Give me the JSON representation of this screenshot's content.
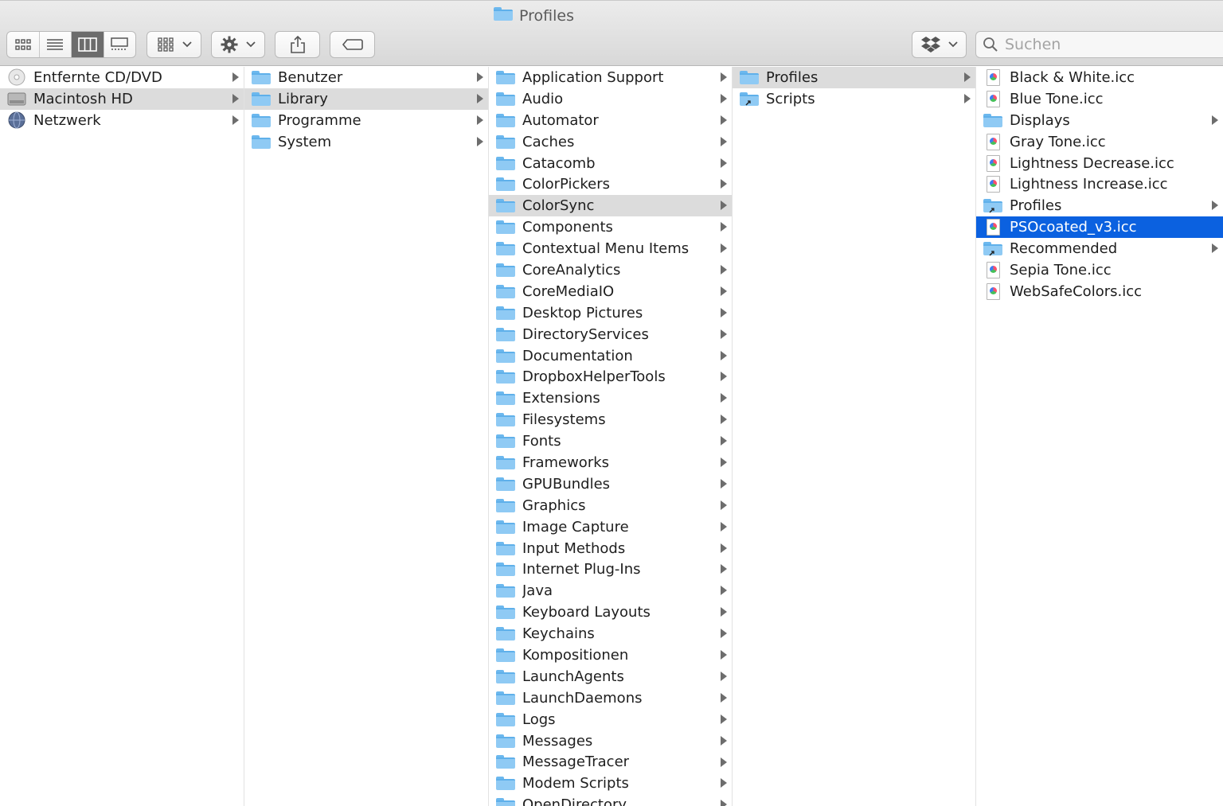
{
  "window": {
    "title": "Profiles"
  },
  "toolbar": {
    "view_buttons": [
      "icon-view",
      "list-view",
      "column-view",
      "gallery-view"
    ],
    "active_view": "column-view",
    "search_placeholder": "Suchen"
  },
  "columns": [
    {
      "items": [
        {
          "label": "Entfernte CD/DVD",
          "icon": "disc-icon",
          "chevron": true,
          "state": ""
        },
        {
          "label": "Macintosh HD",
          "icon": "harddrive-icon",
          "chevron": true,
          "state": "gray"
        },
        {
          "label": "Netzwerk",
          "icon": "globe-icon",
          "chevron": true,
          "state": ""
        }
      ]
    },
    {
      "items": [
        {
          "label": "Benutzer",
          "icon": "folder-icon",
          "chevron": true,
          "state": ""
        },
        {
          "label": "Library",
          "icon": "folder-icon",
          "chevron": true,
          "state": "gray"
        },
        {
          "label": "Programme",
          "icon": "folder-icon",
          "chevron": true,
          "state": ""
        },
        {
          "label": "System",
          "icon": "folder-icon",
          "chevron": true,
          "state": ""
        }
      ]
    },
    {
      "items": [
        {
          "label": "Application Support",
          "icon": "folder-icon",
          "chevron": true,
          "state": ""
        },
        {
          "label": "Audio",
          "icon": "folder-icon",
          "chevron": true,
          "state": ""
        },
        {
          "label": "Automator",
          "icon": "folder-icon",
          "chevron": true,
          "state": ""
        },
        {
          "label": "Caches",
          "icon": "folder-icon",
          "chevron": true,
          "state": ""
        },
        {
          "label": "Catacomb",
          "icon": "folder-icon",
          "chevron": true,
          "state": ""
        },
        {
          "label": "ColorPickers",
          "icon": "folder-icon",
          "chevron": true,
          "state": ""
        },
        {
          "label": "ColorSync",
          "icon": "folder-icon",
          "chevron": true,
          "state": "gray"
        },
        {
          "label": "Components",
          "icon": "folder-icon",
          "chevron": true,
          "state": ""
        },
        {
          "label": "Contextual Menu Items",
          "icon": "folder-icon",
          "chevron": true,
          "state": ""
        },
        {
          "label": "CoreAnalytics",
          "icon": "folder-icon",
          "chevron": true,
          "state": ""
        },
        {
          "label": "CoreMediaIO",
          "icon": "folder-icon",
          "chevron": true,
          "state": ""
        },
        {
          "label": "Desktop Pictures",
          "icon": "folder-icon",
          "chevron": true,
          "state": ""
        },
        {
          "label": "DirectoryServices",
          "icon": "folder-icon",
          "chevron": true,
          "state": ""
        },
        {
          "label": "Documentation",
          "icon": "folder-icon",
          "chevron": true,
          "state": ""
        },
        {
          "label": "DropboxHelperTools",
          "icon": "folder-icon",
          "chevron": true,
          "state": ""
        },
        {
          "label": "Extensions",
          "icon": "folder-icon",
          "chevron": true,
          "state": ""
        },
        {
          "label": "Filesystems",
          "icon": "folder-icon",
          "chevron": true,
          "state": ""
        },
        {
          "label": "Fonts",
          "icon": "folder-icon",
          "chevron": true,
          "state": ""
        },
        {
          "label": "Frameworks",
          "icon": "folder-icon",
          "chevron": true,
          "state": ""
        },
        {
          "label": "GPUBundles",
          "icon": "folder-icon",
          "chevron": true,
          "state": ""
        },
        {
          "label": "Graphics",
          "icon": "folder-icon",
          "chevron": true,
          "state": ""
        },
        {
          "label": "Image Capture",
          "icon": "folder-icon",
          "chevron": true,
          "state": ""
        },
        {
          "label": "Input Methods",
          "icon": "folder-icon",
          "chevron": true,
          "state": ""
        },
        {
          "label": "Internet Plug-Ins",
          "icon": "folder-icon",
          "chevron": true,
          "state": ""
        },
        {
          "label": "Java",
          "icon": "folder-icon",
          "chevron": true,
          "state": ""
        },
        {
          "label": "Keyboard Layouts",
          "icon": "folder-icon",
          "chevron": true,
          "state": ""
        },
        {
          "label": "Keychains",
          "icon": "folder-icon",
          "chevron": true,
          "state": ""
        },
        {
          "label": "Kompositionen",
          "icon": "folder-icon",
          "chevron": true,
          "state": ""
        },
        {
          "label": "LaunchAgents",
          "icon": "folder-icon",
          "chevron": true,
          "state": ""
        },
        {
          "label": "LaunchDaemons",
          "icon": "folder-icon",
          "chevron": true,
          "state": ""
        },
        {
          "label": "Logs",
          "icon": "folder-icon",
          "chevron": true,
          "state": ""
        },
        {
          "label": "Messages",
          "icon": "folder-icon",
          "chevron": true,
          "state": ""
        },
        {
          "label": "MessageTracer",
          "icon": "folder-icon",
          "chevron": true,
          "state": ""
        },
        {
          "label": "Modem Scripts",
          "icon": "folder-icon",
          "chevron": true,
          "state": ""
        },
        {
          "label": "OpenDirectory",
          "icon": "folder-icon",
          "chevron": true,
          "state": ""
        }
      ]
    },
    {
      "items": [
        {
          "label": "Profiles",
          "icon": "folder-icon",
          "chevron": true,
          "state": "gray"
        },
        {
          "label": "Scripts",
          "icon": "folder-alias-icon",
          "chevron": true,
          "state": ""
        }
      ]
    },
    {
      "items": [
        {
          "label": "Black & White.icc",
          "icon": "icc-document-icon",
          "chevron": false,
          "state": ""
        },
        {
          "label": "Blue Tone.icc",
          "icon": "icc-document-icon",
          "chevron": false,
          "state": ""
        },
        {
          "label": "Displays",
          "icon": "folder-icon",
          "chevron": true,
          "state": ""
        },
        {
          "label": "Gray Tone.icc",
          "icon": "icc-document-icon",
          "chevron": false,
          "state": ""
        },
        {
          "label": "Lightness Decrease.icc",
          "icon": "icc-document-icon",
          "chevron": false,
          "state": ""
        },
        {
          "label": "Lightness Increase.icc",
          "icon": "icc-document-icon",
          "chevron": false,
          "state": ""
        },
        {
          "label": "Profiles",
          "icon": "folder-alias-icon",
          "chevron": true,
          "state": ""
        },
        {
          "label": "PSOcoated_v3.icc",
          "icon": "icc-document-icon",
          "chevron": false,
          "state": "blue"
        },
        {
          "label": "Recommended",
          "icon": "folder-alias-icon",
          "chevron": true,
          "state": ""
        },
        {
          "label": "Sepia Tone.icc",
          "icon": "icc-document-icon",
          "chevron": false,
          "state": ""
        },
        {
          "label": "WebSafeColors.icc",
          "icon": "icc-document-icon",
          "chevron": false,
          "state": ""
        }
      ]
    }
  ]
}
